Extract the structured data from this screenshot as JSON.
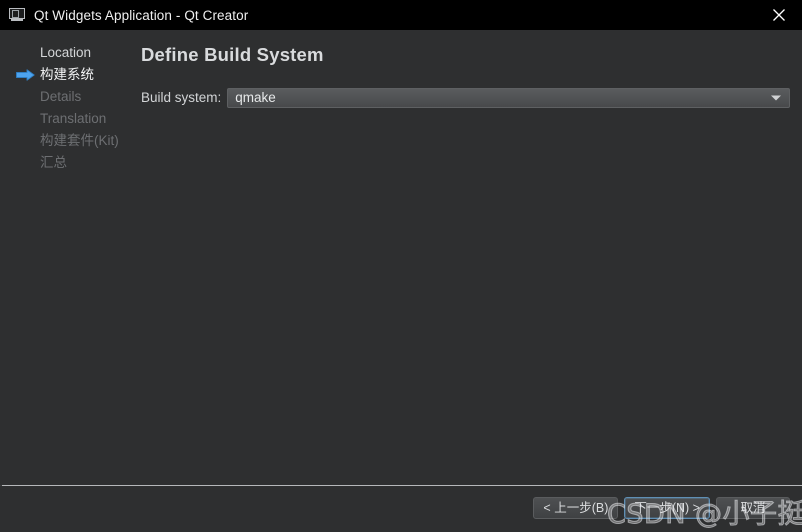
{
  "window": {
    "title": "Qt Widgets Application - Qt Creator",
    "app_icon": "monitor-icon",
    "close_icon": "close-icon",
    "background_color": "#2e2f30",
    "titlebar_color": "#000000"
  },
  "sidebar": {
    "current_marker_icon": "blue-right-arrow-icon",
    "items": [
      {
        "label": "Location",
        "state": "done"
      },
      {
        "label": "构建系统",
        "state": "current"
      },
      {
        "label": "Details",
        "state": "todo"
      },
      {
        "label": "Translation",
        "state": "todo"
      },
      {
        "label": "构建套件(Kit)",
        "state": "todo"
      },
      {
        "label": "汇总",
        "state": "todo"
      }
    ]
  },
  "main": {
    "page_title": "Define Build System",
    "build_system": {
      "label": "Build system:",
      "value": "qmake",
      "dropdown_icon": "chevron-down-icon"
    }
  },
  "footer": {
    "buttons": [
      {
        "label": "< 上一步(B)",
        "name": "back-button",
        "focused": false
      },
      {
        "label": "下一步(N) >",
        "name": "next-button",
        "focused": true
      },
      {
        "label": "取消",
        "name": "cancel-button",
        "focused": false
      }
    ]
  },
  "watermark": {
    "text": "CSDN @小子挺不错"
  }
}
